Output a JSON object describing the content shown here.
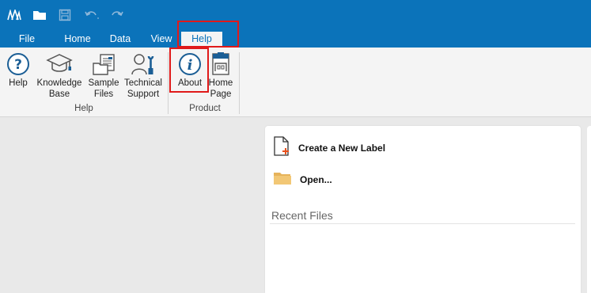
{
  "quick_access": {
    "icons": [
      "app-logo-icon",
      "folder-icon",
      "save-icon",
      "undo-icon",
      "redo-icon"
    ]
  },
  "tabs": [
    {
      "label": "File"
    },
    {
      "label": "Home"
    },
    {
      "label": "Data"
    },
    {
      "label": "View"
    },
    {
      "label": "Help",
      "active": true
    }
  ],
  "ribbon": {
    "help_group": {
      "label": "Help",
      "buttons": [
        {
          "label": "Help",
          "icon": "question-circle-icon"
        },
        {
          "label": "Knowledge\nBase",
          "icon": "graduation-cap-icon"
        },
        {
          "label": "Sample\nFiles",
          "icon": "files-icon"
        },
        {
          "label": "Technical\nSupport",
          "icon": "support-person-icon"
        }
      ]
    },
    "product_group": {
      "label": "Product",
      "buttons": [
        {
          "label": "About",
          "icon": "info-circle-icon"
        },
        {
          "label": "Home\nPage",
          "icon": "home-page-icon"
        }
      ]
    }
  },
  "start_panel": {
    "create_label": "Create a New Label",
    "open_label": "Open...",
    "recent_files_title": "Recent Files"
  },
  "colors": {
    "accent": "#0b73ba",
    "highlight": "#e01a1a",
    "ribbon_bg": "#f4f4f4",
    "workspace_bg": "#e9e9e9"
  }
}
